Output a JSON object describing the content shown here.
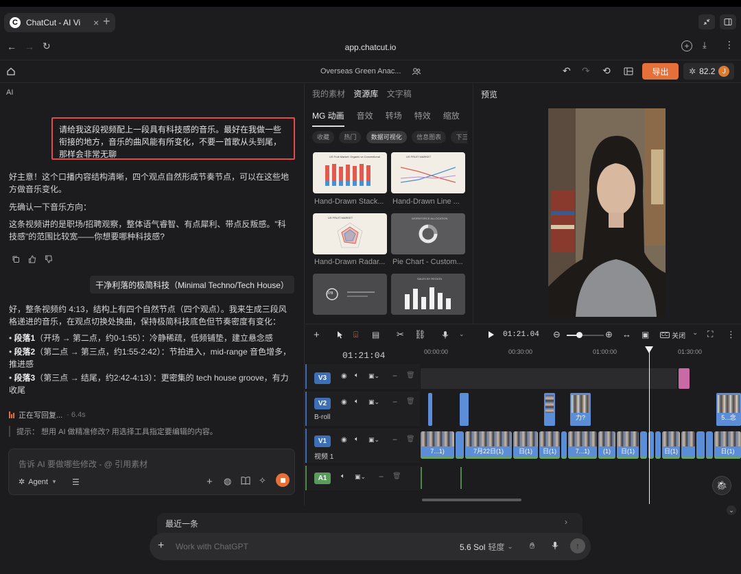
{
  "browser": {
    "tab_title": "ChatCut - AI Vi",
    "url": "app.chatcut.io"
  },
  "app": {
    "project_title": "Overseas Green Anac...",
    "export_label": "导出",
    "credits": "82.2",
    "avatar_letter": "J"
  },
  "chat": {
    "panel_title": "AI",
    "user_message": "请给我这段视频配上一段具有科技感的音乐。最好在我做一些衔接的地方，音乐的曲风能有所变化，不要一首歌从头到尾，那样会非常无聊",
    "reply1": "好主意！这个口播内容结构清晰，四个观点自然形成节奏节点，可以在这些地方做音乐变化。",
    "reply2": "先确认一下音乐方向：",
    "reply3": "这条视频讲的是职场/招聘观察，整体语气睿智、有点犀利、带点反叛感。\"科技感\"的范围比较宽——你想要哪种科技感?",
    "user_choice": "干净利落的极简科技（Minimal Techno/Tech House）",
    "reply4": "好，整条视频约 4:13，结构上有四个自然节点（四个观点）。我来生成三段风格递进的音乐，在观点切换处换曲，保持极简科技底色但节奏密度有变化：",
    "bullets": [
      {
        "title": "段落1",
        "text": "（开场 → 第二点，约0-1:55）：冷静稀疏，低频铺垫，建立悬念感"
      },
      {
        "title": "段落2",
        "text": "（第二点 → 第三点，约1:55-2:42）：节拍进入，mid-range 音色增多，推进感"
      },
      {
        "title": "段落3",
        "text": "（第三点 → 结尾，约2:42-4:13）：更密集的 tech house groove，有力收尾"
      }
    ],
    "status": "正在写回复...",
    "status_time": "· 6.4s",
    "hint": "提示： 想用 AI 做精准修改? 用选择工具指定要编辑的内容。",
    "input_placeholder": "告诉 AI 要做哪些修改 - @ 引用素材",
    "agent_label": "Agent"
  },
  "library": {
    "top_tabs": [
      "我的素材",
      "资源库",
      "文字稿"
    ],
    "active_top_tab": "资源库",
    "sub_tabs": [
      "MG 动画",
      "音效",
      "转场",
      "特效",
      "缩放"
    ],
    "chips": [
      "收藏",
      "热门",
      "数据可视化",
      "信息图表",
      "下三分"
    ],
    "cards": [
      {
        "label": "Hand-Drawn Stack...",
        "inner": "US Fruit Market: Organic vs Conventional"
      },
      {
        "label": "Hand-Drawn Line ...",
        "inner": "US FRUIT MARKET"
      },
      {
        "label": "Hand-Drawn Radar...",
        "inner": "US FRUIT MARKET"
      },
      {
        "label": "Pie Chart - Custom...",
        "inner": "WORKFORCE ALLOCATION"
      },
      {
        "label": "",
        "inner": "378"
      },
      {
        "label": "",
        "inner": "SALES BY REGION"
      }
    ]
  },
  "preview": {
    "title": "预览"
  },
  "timeline": {
    "timecode": "01:21.04",
    "playhead_time": "01:21:04",
    "captions_label": "关闭",
    "ruler": [
      "00:00:00",
      "00:30:00",
      "01:00:00",
      "01:30:00"
    ],
    "tracks": [
      {
        "id": "V3",
        "label": ""
      },
      {
        "id": "V2",
        "label": "B-roll"
      },
      {
        "id": "V1",
        "label": "视频 1"
      },
      {
        "id": "A1",
        "label": ""
      }
    ],
    "v2_clip_labels": [
      "力?",
      "5...念"
    ],
    "v1_clip_labels": [
      "7...1)",
      "7月22日(1)",
      "日(1)",
      "日(1)",
      "7...1)",
      "(1)",
      "日(1)",
      "日(1)",
      "日(1)"
    ]
  },
  "bottom": {
    "recent_label": "最近一条",
    "placeholder": "Work with ChatGPT",
    "model_label": "5.6 Sol",
    "model_mode": "轻度"
  },
  "colors": {
    "accent": "#e6703a",
    "highlight_border": "#e5484d",
    "v1_clip": "#5b8ed6"
  }
}
